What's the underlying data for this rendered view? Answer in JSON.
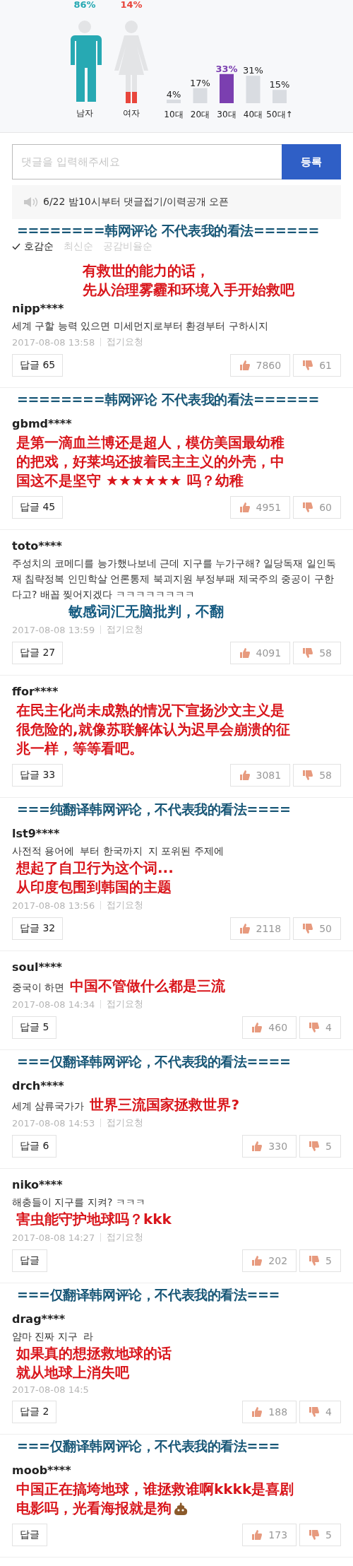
{
  "demographics": {
    "gender": [
      {
        "kind": "man",
        "label": "남자",
        "value": "86%",
        "color": "#27a9b3"
      },
      {
        "kind": "woman",
        "label": "여자",
        "value": "14%",
        "color": "#e8463c"
      }
    ],
    "age_chart": {
      "chart_data": {
        "type": "bar",
        "categories": [
          "10대",
          "20대",
          "30대",
          "40대",
          "50대↑"
        ],
        "series": [
          {
            "color": "#d9dce1",
            "value_labels": [
              "4%",
              "17%",
              "33%",
              "31%",
              "15%"
            ],
            "colors": [
              "#d9dce1",
              "#d9dce1",
              "#7b3fb0",
              "#d9dce1",
              "#d9dce1"
            ],
            "values": [
              4,
              17,
              33,
              31,
              15
            ]
          }
        ]
      }
    }
  },
  "comment_form": {
    "placeholder": "댓글을 입력해주세요",
    "submit": "등록"
  },
  "notice": {
    "text": "6/22 밤10시부터 댓글접기/이력공개 오픈"
  },
  "feed": [
    {
      "kind": "banner",
      "text": "========韩网评论 不代表我的看法======"
    },
    {
      "kind": "sort",
      "options": [
        {
          "label": "호감순",
          "selected": true
        },
        {
          "label": "최신순",
          "selected": false
        },
        {
          "label": "공감비율순",
          "selected": false
        }
      ]
    },
    {
      "kind": "comment",
      "user": "nipp****",
      "lead_note": {
        "kind": "translation",
        "emoji": false,
        "lines": [
          "有救世的能力的话，",
          "先从治理雾霾和环境入手开始救吧"
        ]
      },
      "text_parts": [
        "세계 구할 능력 있으면 미세먼지로부터 환경부터 구하시지"
      ],
      "time": "2017-08-08 13:58",
      "fold": "접기요청",
      "reply": "답글 65",
      "likes": "7860",
      "dislikes": "61"
    },
    {
      "kind": "banner",
      "text": "========韩网评论 不代表我的看法======"
    },
    {
      "kind": "comment",
      "user": "gbmd****",
      "note": {
        "kind": "translation",
        "emoji": false,
        "lines": [
          "是第一滴血兰博还是超人，模仿美国最幼稚",
          "的把戏，好莱坞还披着民主主义的外壳，中",
          "国这不是坚守 ★★★★★★ 吗？幼稚"
        ]
      },
      "reply": "답글 45",
      "likes": "4951",
      "dislikes": "60"
    },
    {
      "kind": "comment",
      "user": "toto****",
      "text_parts": [
        "주성치의 코메디를 능가했나보네 근데 지구를 누가구해? 일당독재 일인독재 침략정복 인민학살 언론통제 북괴지원 부정부패 제국주의 중공이 구한다고? 배꼽 찢어지겠다 ㅋㅋㅋㅋㅋㅋㅋㅋ"
      ],
      "note": {
        "kind": "remark",
        "emoji": false,
        "lines": [
          "敏感词汇无脑批判，不翻"
        ]
      },
      "time": "2017-08-08 13:59",
      "fold": "접기요청",
      "reply": "답글 27",
      "likes": "4091",
      "dislikes": "58"
    },
    {
      "kind": "comment",
      "user": "ffor****",
      "note": {
        "kind": "translation",
        "emoji": false,
        "lines": [
          "在民主化尚未成熟的情况下宣扬沙文主义是",
          "很危险的,就像苏联解体认为迟早会崩溃的征",
          "兆一样，等等看吧。"
        ]
      },
      "reply": "답글 33",
      "likes": "3081",
      "dislikes": "58"
    },
    {
      "kind": "banner",
      "text": "===纯翻译韩网评论，不代表我的看法===="
    },
    {
      "kind": "comment",
      "user": "lst9****",
      "text_parts": [
        "사전적 용어에",
        "부터 한국까지",
        "지 포위된 주제에"
      ],
      "note": {
        "kind": "translation",
        "emoji": false,
        "lines": [
          "想起了自卫行为这个词...",
          "从印度包围到韩国的主题"
        ]
      },
      "time": "2017-08-08 13:56",
      "fold": "접기요청",
      "reply": "답글 32",
      "likes": "2118",
      "dislikes": "50"
    },
    {
      "kind": "comment",
      "user": "soul****",
      "text_parts": [
        "중국이 하면"
      ],
      "inline_note": {
        "kind": "translation",
        "emoji": false,
        "lines": [
          "中国不管做什么都是三流"
        ]
      },
      "time": "2017-08-08 14:34",
      "fold": "접기요청",
      "reply": "답글 5",
      "likes": "460",
      "dislikes": "4"
    },
    {
      "kind": "banner",
      "text": "===仅翻译韩网评论，不代表我的看法===="
    },
    {
      "kind": "comment",
      "user": "drch****",
      "text_parts": [
        "세계 삼류국가가"
      ],
      "inline_note": {
        "kind": "translation",
        "emoji": false,
        "lines": [
          "世界三流国家拯救世界?"
        ]
      },
      "time": "2017-08-08 14:53",
      "fold": "접기요청",
      "reply": "답글 6",
      "likes": "330",
      "dislikes": "5"
    },
    {
      "kind": "comment",
      "user": "niko****",
      "text_parts": [
        "해충들이 지구를 지켜? ㅋㅋㅋ"
      ],
      "time": "2017-08-08 14:27",
      "fold": "접기요청",
      "note": {
        "kind": "translation",
        "emoji": false,
        "lines": [
          "害虫能守护地球吗？kkk"
        ]
      },
      "reply": "답글",
      "likes": "202",
      "dislikes": "5"
    },
    {
      "kind": "banner",
      "text": "===仅翻译韩网评论，不代表我的看法==="
    },
    {
      "kind": "comment",
      "user": "drag****",
      "text_parts": [
        "얌마 진짜 지구",
        "라"
      ],
      "time": "2017-08-08 14:5",
      "note": {
        "kind": "translation",
        "emoji": false,
        "lines": [
          "如果真的想拯救地球的话",
          "就从地球上消失吧"
        ]
      },
      "reply": "답글 2",
      "likes": "188",
      "dislikes": "4"
    },
    {
      "kind": "banner",
      "text": "===仅翻译韩网评论，不代表我的看法==="
    },
    {
      "kind": "comment",
      "user": "moob****",
      "note": {
        "kind": "translation",
        "emoji": true,
        "lines": [
          "中国正在搞垮地球，谁拯救谁啊kkkk是喜剧",
          "电影吗，光看海报就是狗"
        ]
      },
      "reply": "답글",
      "likes": "173",
      "dislikes": "5"
    }
  ]
}
